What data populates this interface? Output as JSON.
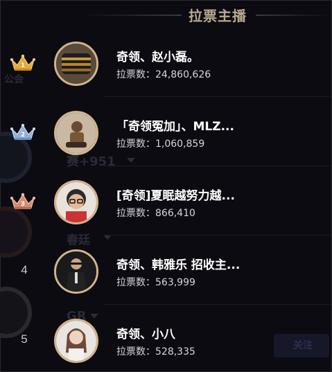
{
  "header": {
    "title": "拉票主播"
  },
  "labels": {
    "votes_prefix": "拉票数："
  },
  "colors": {
    "accent_gold": "#d4b48c",
    "title_tan": "#b9a98e",
    "background": "#0b0b11"
  },
  "background_fragments": {
    "t1": "公会",
    "t2": "赛+951",
    "t3": "春廷",
    "t4": "GR",
    "t5": "关注"
  },
  "streamers": [
    {
      "rank": 1,
      "rank_icon": "gold-crown-icon",
      "name": "奇领、赵小磊。",
      "votes": "24,860,626"
    },
    {
      "rank": 2,
      "rank_icon": "silver-crown-icon",
      "name": "「奇领冤加」、MLZ...",
      "votes": "1,060,859"
    },
    {
      "rank": 3,
      "rank_icon": "bronze-crown-icon",
      "name": "[奇领]夏眠越努力越...",
      "votes": "866,410"
    },
    {
      "rank": 4,
      "rank_label": "4",
      "name": "奇领、韩雅乐 招收主...",
      "votes": "563,999"
    },
    {
      "rank": 5,
      "rank_label": "5",
      "name": "奇领、小八",
      "votes": "528,335"
    }
  ]
}
